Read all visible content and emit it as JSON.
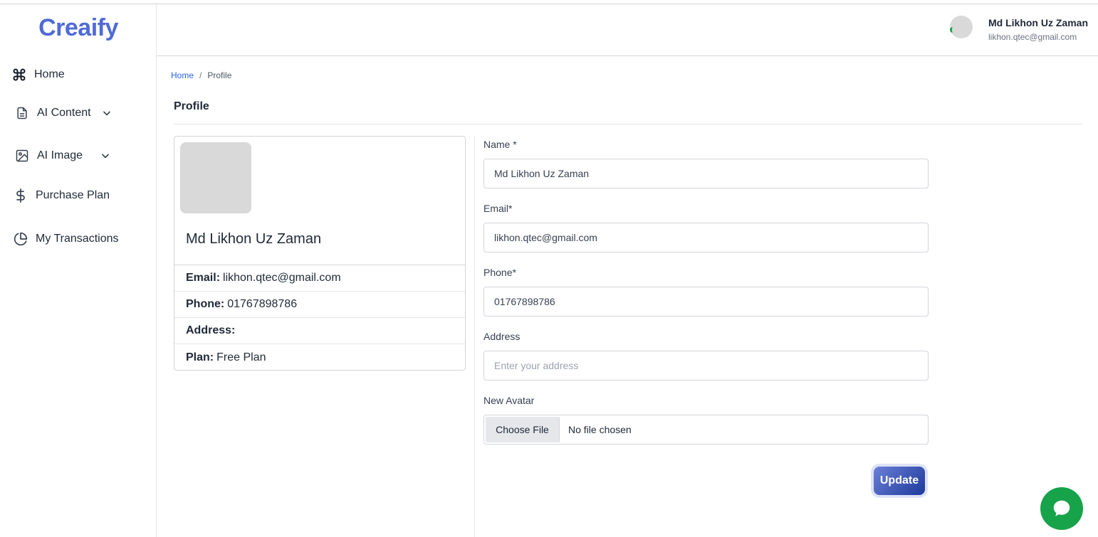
{
  "app": {
    "logo": "Creaify"
  },
  "sidebar": {
    "items": [
      {
        "label": "Home",
        "icon": "command-icon"
      },
      {
        "label": "AI Content",
        "icon": "document-icon",
        "expandable": true
      },
      {
        "label": "AI Image",
        "icon": "image-icon",
        "expandable": true
      },
      {
        "label": "Purchase Plan",
        "icon": "dollar-icon"
      },
      {
        "label": "My Transactions",
        "icon": "pie-chart-icon"
      }
    ]
  },
  "header": {
    "user_name": "Md Likhon Uz Zaman",
    "user_email": "likhon.qtec@gmail.com"
  },
  "breadcrumb": {
    "home": "Home",
    "separator": "/",
    "current": "Profile"
  },
  "page": {
    "title": "Profile"
  },
  "profile_card": {
    "name": "Md Likhon Uz Zaman",
    "rows": [
      {
        "label": "Email:",
        "value": "likhon.qtec@gmail.com"
      },
      {
        "label": "Phone:",
        "value": "01767898786"
      },
      {
        "label": "Address:",
        "value": ""
      },
      {
        "label": "Plan:",
        "value": "Free Plan"
      }
    ]
  },
  "form": {
    "name_label": "Name *",
    "name_value": "Md Likhon Uz Zaman",
    "email_label": "Email*",
    "email_value": "likhon.qtec@gmail.com",
    "phone_label": "Phone*",
    "phone_value": "01767898786",
    "address_label": "Address",
    "address_placeholder": "Enter your address",
    "avatar_label": "New Avatar",
    "file_button": "Choose File",
    "file_status": "No file chosen",
    "submit_label": "Update"
  },
  "colors": {
    "brand": "#4f6bd6",
    "link": "#2563eb",
    "chat": "#16a34a",
    "update_gradient_start": "#6a7fd8",
    "update_gradient_end": "#1e3a9a"
  }
}
